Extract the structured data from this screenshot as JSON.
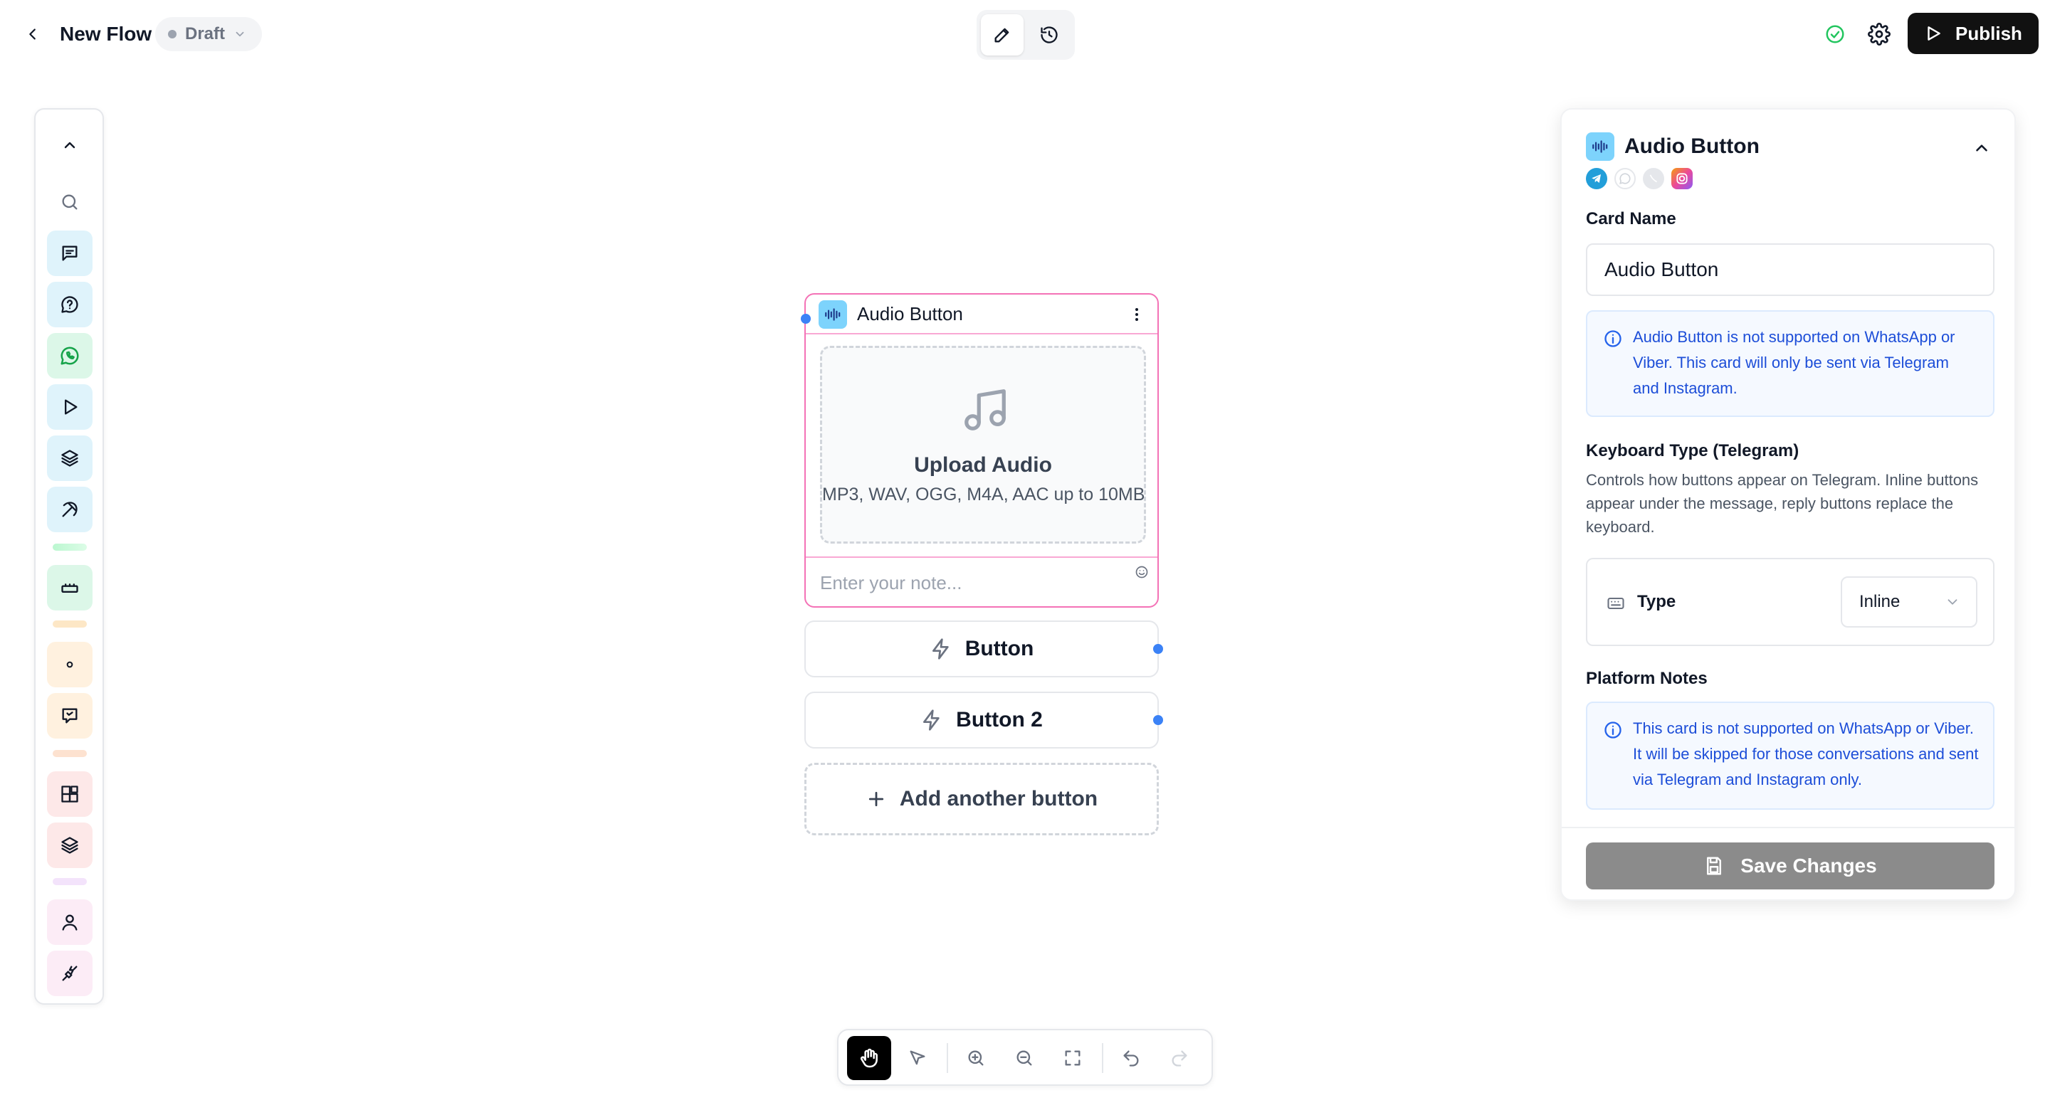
{
  "header": {
    "title": "New Flow",
    "status": "Draft",
    "publish_label": "Publish"
  },
  "node": {
    "title": "Audio Button",
    "upload_title": "Upload Audio",
    "upload_subtitle": "MP3, WAV, OGG, M4A, AAC up to 10MB",
    "note_placeholder": "Enter your note...",
    "buttons": [
      {
        "label": "Button"
      },
      {
        "label": "Button 2"
      }
    ],
    "add_button_label": "Add another button"
  },
  "panel": {
    "title": "Audio Button",
    "platforms": [
      "telegram-icon",
      "whatsapp-icon",
      "viber-icon",
      "instagram-icon"
    ],
    "card_name_label": "Card Name",
    "card_name_value": "Audio Button",
    "support_notice": "Audio Button is not supported on WhatsApp or Viber. This card will only be sent via Telegram and Instagram.",
    "keyboard_type_heading": "Keyboard Type (Telegram)",
    "keyboard_type_desc": "Controls how buttons appear on Telegram. Inline buttons appear under the message, reply buttons replace the keyboard.",
    "type_label": "Type",
    "type_value": "Inline",
    "platform_notes_heading": "Platform Notes",
    "platform_notes_text": "This card is not supported on WhatsApp or Viber. It will be skipped for those conversations and sent via Telegram and Instagram only.",
    "save_label": "Save Changes"
  },
  "colors": {
    "accent_pink": "#f472b6",
    "handle_blue": "#3b82f6",
    "info_text": "#1d4ed8",
    "publish_bg": "#111111",
    "save_disabled": "#8b8b8b"
  }
}
